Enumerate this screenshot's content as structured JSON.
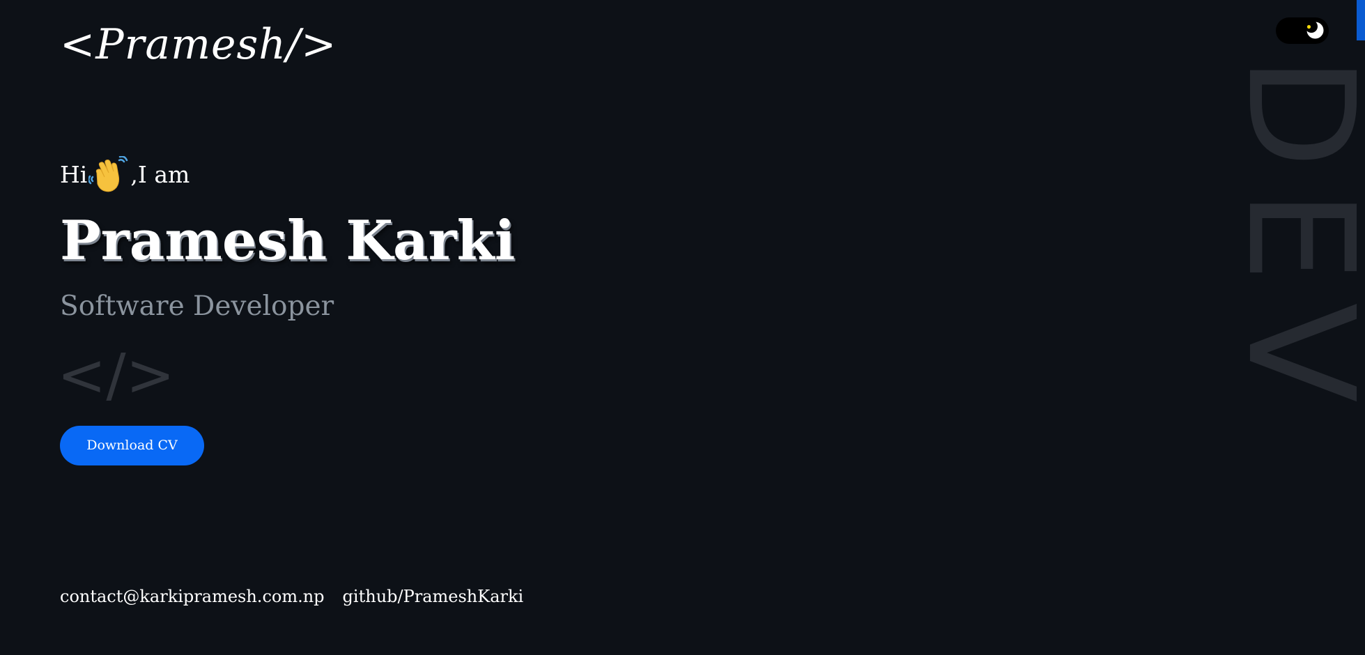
{
  "header": {
    "logo": "<Pramesh/>",
    "theme_toggle_icon": "moon-icon"
  },
  "hero": {
    "greeting_hi": "Hi",
    "greeting_icon": "waving-hand-icon",
    "greeting_rest": ",I am",
    "name": "Pramesh Karki",
    "role": "Software Developer",
    "code_glyph": "</>",
    "download_label": "Download CV"
  },
  "background_word": "DEV",
  "footer": {
    "email": "contact@karkipramesh.com.np",
    "github": "github/PrameshKarki"
  },
  "colors": {
    "background": "#0d1117",
    "accent": "#0969f5",
    "muted_text": "#8b949e"
  }
}
